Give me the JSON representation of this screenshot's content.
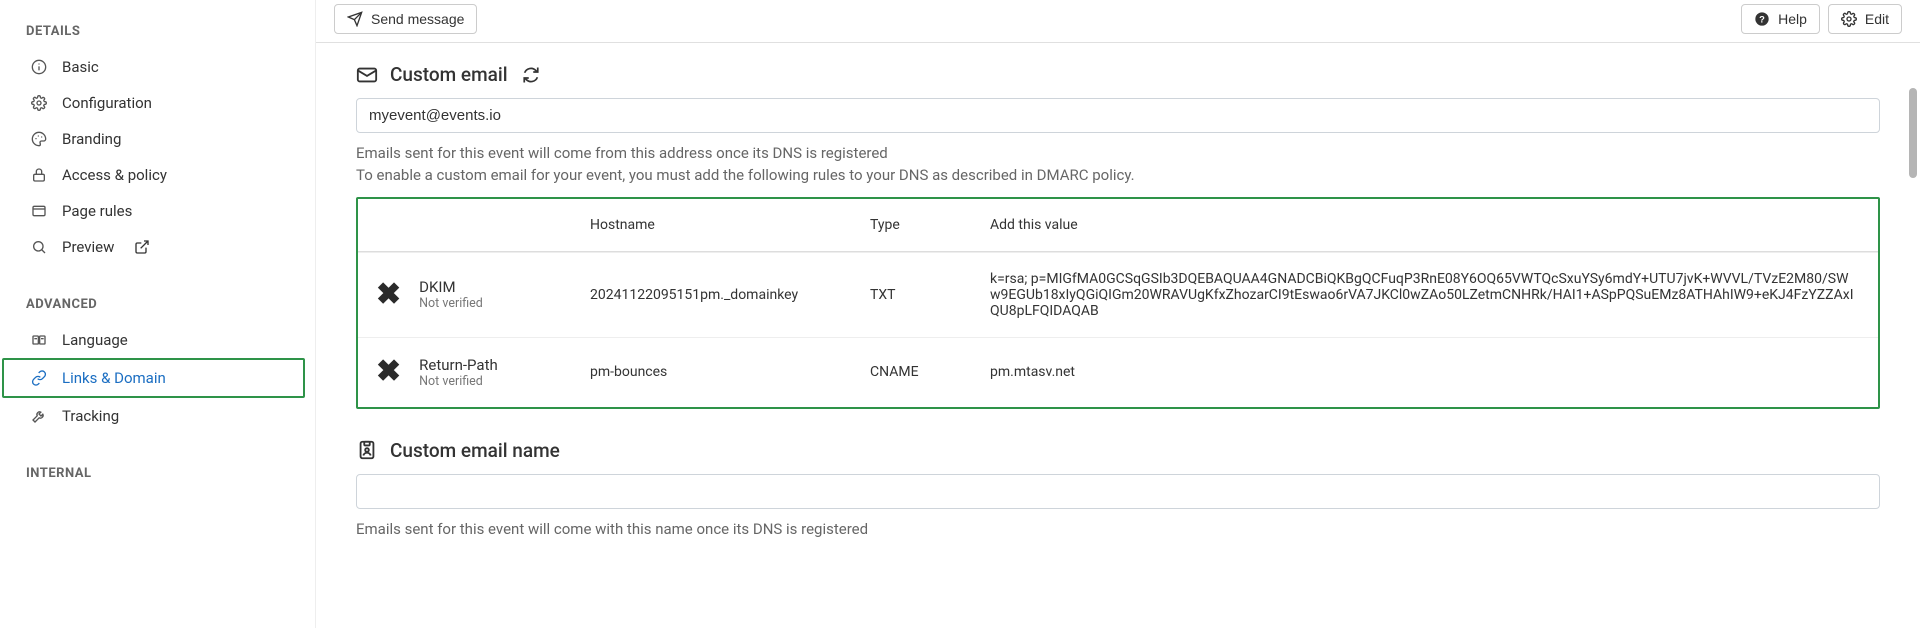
{
  "sidebar": {
    "sections": {
      "details": {
        "title": "DETAILS",
        "items": [
          {
            "label": "Basic"
          },
          {
            "label": "Configuration"
          },
          {
            "label": "Branding"
          },
          {
            "label": "Access & policy"
          },
          {
            "label": "Page rules"
          },
          {
            "label": "Preview"
          }
        ]
      },
      "advanced": {
        "title": "ADVANCED",
        "items": [
          {
            "label": "Language"
          },
          {
            "label": "Links & Domain"
          },
          {
            "label": "Tracking"
          }
        ]
      },
      "internal": {
        "title": "INTERNAL"
      }
    }
  },
  "topbar": {
    "send_label": "Send message",
    "help_label": "Help",
    "edit_label": "Edit"
  },
  "custom_email": {
    "title": "Custom email",
    "value": "myevent@events.io",
    "helper_line1": "Emails sent for this event will come from this address once its DNS is registered",
    "helper_line2": "To enable a custom email for your event, you must add the following rules to your DNS as described in DMARC policy.",
    "columns": {
      "hostname": "Hostname",
      "type": "Type",
      "value": "Add this value"
    },
    "rows": [
      {
        "name": "DKIM",
        "status": "Not verified",
        "hostname": "20241122095151pm._domainkey",
        "type": "TXT",
        "value": "k=rsa; p=MIGfMA0GCSqGSIb3DQEBAQUAA4GNADCBiQKBgQCFuqP3RnE08Y6OQ65VWTQcSxuYSy6mdY+UTU7jvK+WVVL/TVzE2M80/SWw9EGUb18xIyQGiQIGm20WRAVUgKfxZhozarCI9tEswao6rVA7JKCl0wZAo50LZetmCNHRk/HAI1+ASpPQSuEMz8ATHAhIW9+eKJ4FzYZZAxIQU8pLFQIDAQAB"
      },
      {
        "name": "Return-Path",
        "status": "Not verified",
        "hostname": "pm-bounces",
        "type": "CNAME",
        "value": "pm.mtasv.net"
      }
    ]
  },
  "custom_email_name": {
    "title": "Custom email name",
    "value": "",
    "helper": "Emails sent for this event will come with this name once its DNS is registered"
  }
}
